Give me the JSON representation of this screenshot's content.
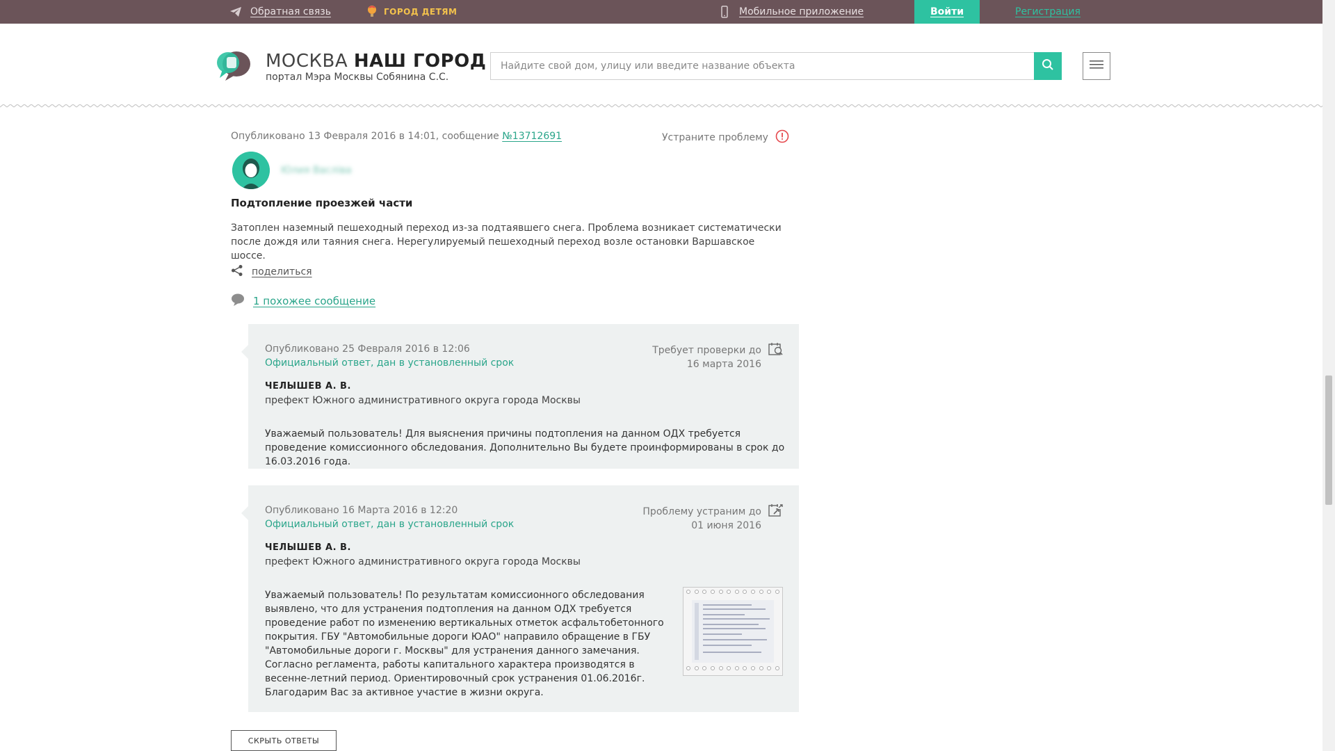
{
  "topbar": {
    "feedback": "Обратная связь",
    "kids": "ГОРОД ДЕТЯМ",
    "mobile": "Мобильное приложение",
    "login": "Войти",
    "register": "Регистрация"
  },
  "header": {
    "logo_title_regular": "МОСКВА ",
    "logo_title_bold": "НАШ ГОРОД",
    "logo_subtitle": "портал Мэра Москвы Собянина С.С.",
    "search_placeholder": "Найдите свой дом, улицу или введите название объекта"
  },
  "post": {
    "published_prefix": "Опубликовано 13 Февраля 2016 в 14:01, сообщение ",
    "message_number": "№13712691",
    "fix_problem": "Устраните проблему",
    "author_name": "Юлия Васліва",
    "title": "Подтопление проезжей части",
    "body": "Затоплен наземный пешеходный переход из-за подтаявшего снега. Проблема возникает систематически после дождя или таяния снега. Нерегулируемый пешеходный переход возле остановки Варшавское шоссе.",
    "share": "поделиться",
    "similar": "1 похожее сообщение"
  },
  "answers": [
    {
      "published": "Опубликовано 25 Февраля 2016 в 12:06",
      "status": "Официальный ответ, дан в установленный срок",
      "deadline_label": "Требует проверки до",
      "deadline_date": "16 марта 2016",
      "author": "ЧЕЛЫШЕВ А. В.",
      "role": "префект Южного административного округа города Москвы",
      "text": "Уважаемый пользователь! Для выяснения причины подтопления на данном ОДХ требуется проведение комиссионного обследования. Дополнительно Вы будете проинформированы в срок до 16.03.2016 года."
    },
    {
      "published": "Опубликовано 16 Марта 2016 в 12:20",
      "status": "Официальный ответ, дан в установленный срок",
      "deadline_label": "Проблему устраним до",
      "deadline_date": "01 июня 2016",
      "author": "ЧЕЛЫШЕВ А. В.",
      "role": "префект Южного административного округа города Москвы",
      "text": "Уважаемый пользователь! По результатам комиссионного обследования выявлено, что для устранения подтопления на данном ОДХ требуется проведение работ по изменению вертикальных отметок асфальтобетонного покрытия. ГБУ \"Автомобильные дороги ЮАО\" направило обращение в ГБУ \"Автомобильные дороги г. Москвы\" для устранения данного замечания. Согласно регламента, работы капитального характера производятся в весенне-летний период. Ориентировочный срок устранения 01.06.2016г. Благодарим Вас за активное участие в жизни округа."
    }
  ],
  "hide_answers": "СКРЫТЬ ОТВЕТЫ",
  "colors": {
    "topbar": "#6b5459",
    "accent": "#2ec2a1",
    "answer_bg": "#eef1f1"
  }
}
